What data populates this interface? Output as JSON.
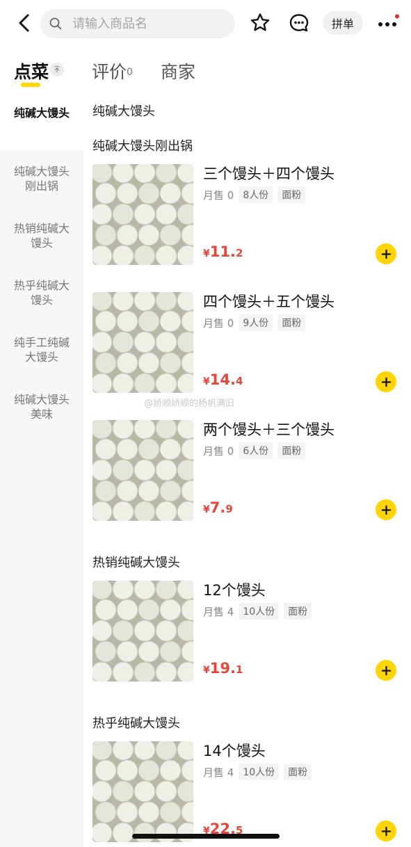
{
  "header": {
    "search_placeholder": "请输入商品名",
    "group_order_label": "拼单",
    "icons": [
      "back-icon",
      "search-icon",
      "star-icon",
      "chat-icon",
      "more-icon"
    ],
    "notification_dot_color": "#e02e24"
  },
  "tabs": {
    "order": "点菜",
    "review": "评价",
    "review_count": "0",
    "merchant": "商家",
    "active_underline_color": "#ffd400"
  },
  "sidebar": {
    "items": [
      {
        "label": "纯碱大馒头"
      },
      {
        "label": "纯碱大馒头刚出锅"
      },
      {
        "label": "热销纯碱大馒头"
      },
      {
        "label": "热乎纯碱大馒头"
      },
      {
        "label": "纯手工纯碱大馒头"
      },
      {
        "label": "纯碱大馒头美味"
      }
    ]
  },
  "content": {
    "top_heading": "纯碱大馒头",
    "sections": [
      {
        "title": "纯碱大馒头刚出锅"
      },
      {
        "title": "热销纯碱大馒头"
      },
      {
        "title": "热乎纯碱大馒头"
      }
    ],
    "products": [
      {
        "name": "三个馒头＋四个馒头",
        "sold": "月售 0",
        "serving": "8人份",
        "ingredient": "面粉",
        "currency": "¥",
        "price_int": "11.",
        "price_dec": "2"
      },
      {
        "name": "四个馒头＋五个馒头",
        "sold": "月售 0",
        "serving": "9人份",
        "ingredient": "面粉",
        "currency": "¥",
        "price_int": "14.",
        "price_dec": "4"
      },
      {
        "name": "两个馒头＋三个馒头",
        "sold": "月售 0",
        "serving": "6人份",
        "ingredient": "面粉",
        "currency": "¥",
        "price_int": "7.",
        "price_dec": "9"
      },
      {
        "name": "12个馒头",
        "sold": "月售 4",
        "serving": "10人份",
        "ingredient": "面粉",
        "currency": "¥",
        "price_int": "19.",
        "price_dec": "1"
      },
      {
        "name": "14个馒头",
        "sold": "月售 4",
        "serving": "10人份",
        "ingredient": "面粉",
        "currency": "¥",
        "price_int": "22.",
        "price_dec": "5"
      }
    ],
    "price_color": "#e4473a",
    "add_button_color": "#ffd400"
  },
  "watermark": "@娇顺娇顺的杨帆满旧"
}
